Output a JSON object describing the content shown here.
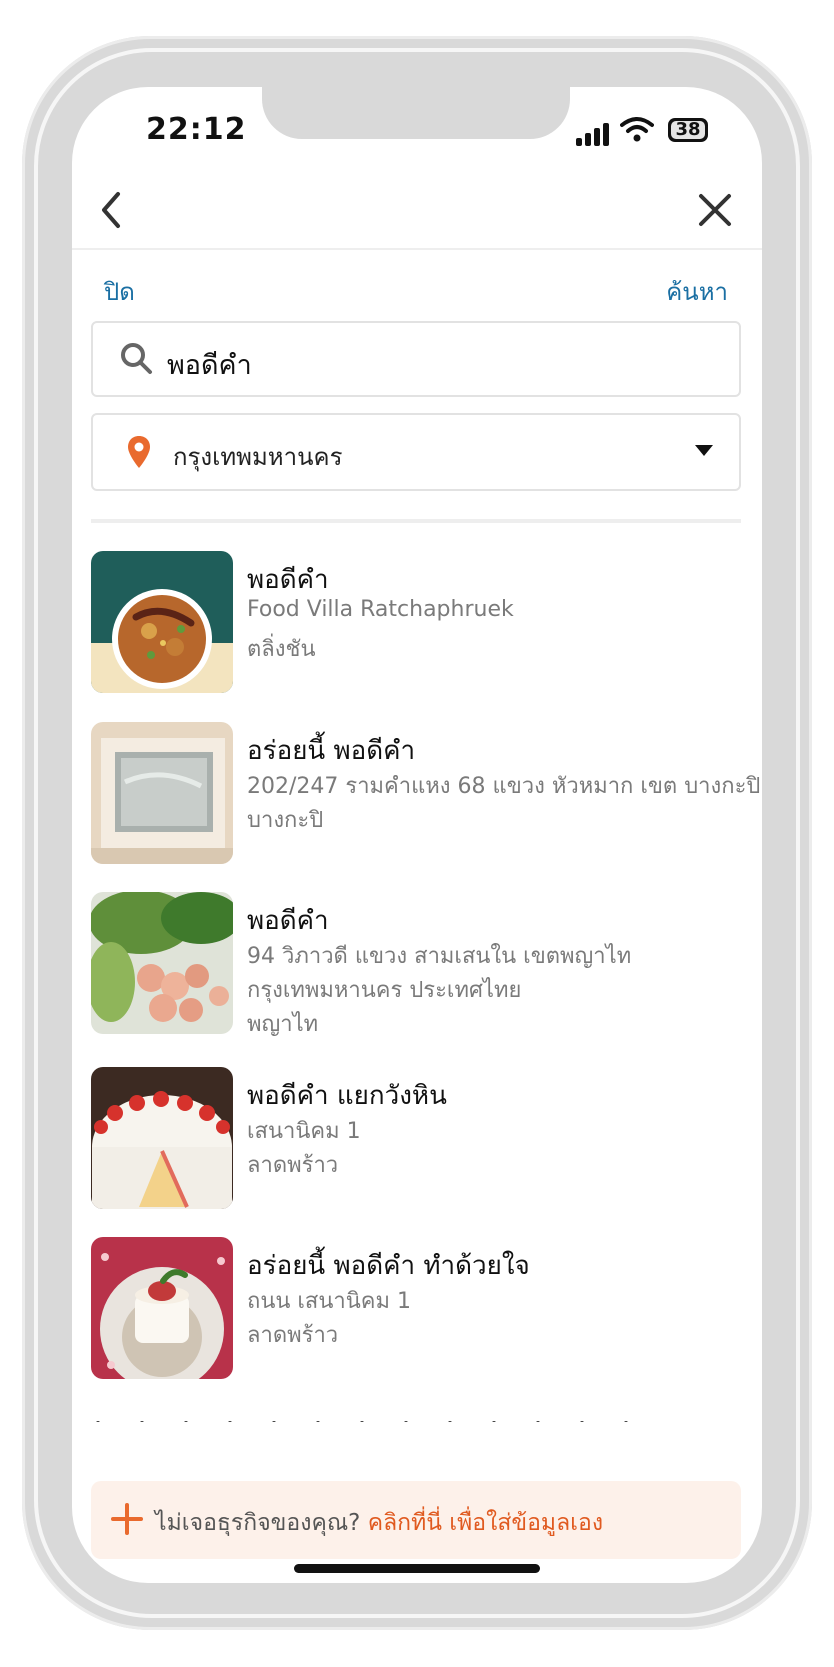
{
  "status": {
    "time": "22:12",
    "battery": "38"
  },
  "header": {
    "close_label": "ปิด",
    "search_label": "ค้นหา"
  },
  "search": {
    "value": "พอดีคำ"
  },
  "location": {
    "value": "กรุงเทพมหานคร"
  },
  "results": [
    {
      "title": "พอดีคำ",
      "lines": [
        "Food Villa Ratchaphruek",
        "ตลิ่งชัน"
      ]
    },
    {
      "title": "อร่อยนี้ พอดีคำ",
      "lines": [
        "202/247 รามคำแหง 68 แขวง หัวหมาก เขต บางกะปิ",
        "บางกะปิ"
      ]
    },
    {
      "title": "พอดีคำ",
      "lines": [
        "94 วิภาวดี แขวง สามเสนใน เขตพญาไท",
        "กรุงเทพมหานคร ประเทศไทย",
        "พญาไท"
      ]
    },
    {
      "title": "พอดีคำ แยกวังหิน",
      "lines": [
        "เสนานิคม 1",
        "ลาดพร้าว"
      ]
    },
    {
      "title": "อร่อยนี้ พอดีคำ ทำด้วยใจ",
      "lines": [
        "ถนน เสนานิคม 1",
        "ลาดพร้าว"
      ]
    }
  ],
  "banner": {
    "text": "ไม่เจอธุรกิจของคุณ? ",
    "link": "คลิกที่นี่ เพื่อใส่ข้อมูลเอง"
  },
  "colors": {
    "link_blue": "#1a6fa3",
    "accent_orange": "#e96a2e",
    "banner_bg": "#fdf1ea"
  }
}
